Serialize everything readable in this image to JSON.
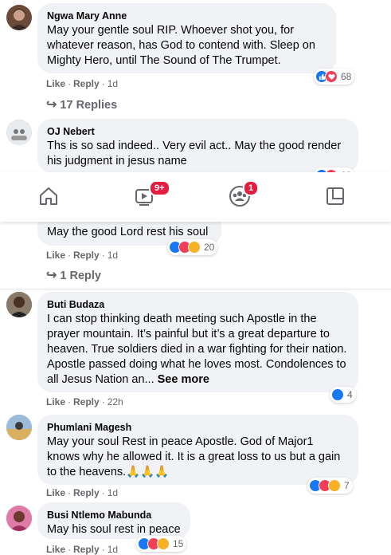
{
  "comments": [
    {
      "name": "Ngwa Mary Anne",
      "text": "May your gentle soul RIP. Whoever shot you, for whatever reason, has God to contend with. Sleep on Mighty Hero, until The Sound of The Trumpet.",
      "like_label": "Like",
      "reply_label": "Reply",
      "time": "1d",
      "reaction_count": "68",
      "reactions": [
        "like-icon",
        "love-icon"
      ],
      "replies_label": "17 Replies"
    },
    {
      "name": "OJ Nebert",
      "text": "Ths is so sad indeed.. Very evil act.. May the good render his judgment in jesus name",
      "reaction_count": "33",
      "reactions": [
        "like-icon",
        "love-icon"
      ]
    },
    {
      "text": "May the good Lord rest his soul",
      "like_label": "Like",
      "reply_label": "Reply",
      "time": "1d",
      "reaction_count": "20",
      "reactions": [
        "like-icon",
        "love-icon",
        "care-icon"
      ],
      "replies_label": "1 Reply"
    },
    {
      "name": "Buti Budaza",
      "text": "I can stop thinking death meeting such Apostle in the prayer mountain. It’s painful but it’s a great departure to heaven. True soldiers died in a war fighting for their nation. Apostle passed doing what he loves most. Condolences to all Jesus Nation an... ",
      "see_more": "See more",
      "like_label": "Like",
      "reply_label": "Reply",
      "time": "22h",
      "reaction_count": "4",
      "reactions": [
        "like-icon"
      ]
    },
    {
      "name": "Phumlani Magesh",
      "text": "May your soul Rest in peace Apostle. God of Major1 knows why he allowed it. It is a great loss to us but a gain to the heavens.🙏🙏🙏",
      "like_label": "Like",
      "reply_label": "Reply",
      "time": "1d",
      "reaction_count": "7",
      "reactions": [
        "like-icon",
        "love-icon",
        "sad-icon"
      ]
    },
    {
      "name": "Busi Ntlemo Mabunda",
      "text": "May his soul rest in peace",
      "like_label": "Like",
      "reply_label": "Reply",
      "time": "1d",
      "reaction_count": "15",
      "reactions": [
        "like-icon",
        "love-icon",
        "care-icon"
      ]
    }
  ],
  "nav": {
    "home_icon": "home-icon",
    "watch_icon": "video-icon",
    "watch_badge": "9+",
    "groups_icon": "groups-icon",
    "groups_badge": "1",
    "gaming_icon": "gaming-icon"
  },
  "colors": {
    "like": "#1877f2",
    "love": "#f33e58",
    "care": "#f7b125",
    "badge": "#e41e3f",
    "bubble": "#f0f2f5"
  }
}
